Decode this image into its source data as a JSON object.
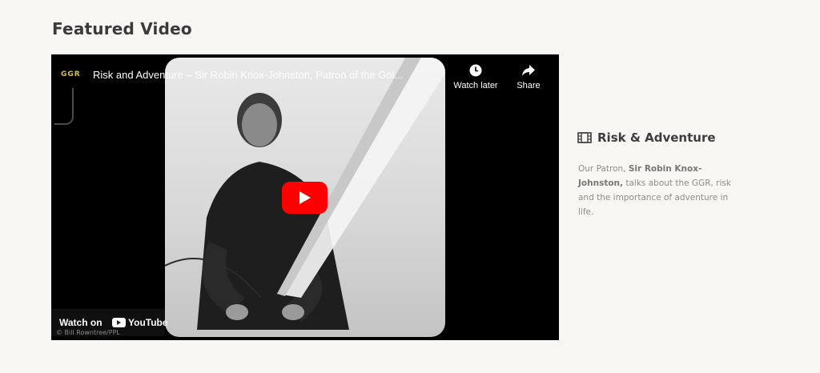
{
  "section": {
    "title": "Featured Video"
  },
  "video": {
    "title": "Risk and Adventure – Sir Robin Knox-Johnston, Patron of the Gol...",
    "channel_logo": "GGR",
    "watch_later_label": "Watch later",
    "share_label": "Share",
    "watch_on_label": "Watch on",
    "youtube_label": "YouTube",
    "credit": "© Bill Rowntree/PPL",
    "icons": {
      "watch_later": "clock-icon",
      "share": "share-arrow-icon",
      "play": "play-icon"
    },
    "play_button_color": "#ff0000"
  },
  "info": {
    "icon": "film-icon",
    "title": "Risk & Adventure",
    "body_prefix": "Our Patron, ",
    "body_name": "Sir Robin Knox-Johnston,",
    "body_suffix": " talks about the GGR, risk and the importance of adventure in life."
  }
}
